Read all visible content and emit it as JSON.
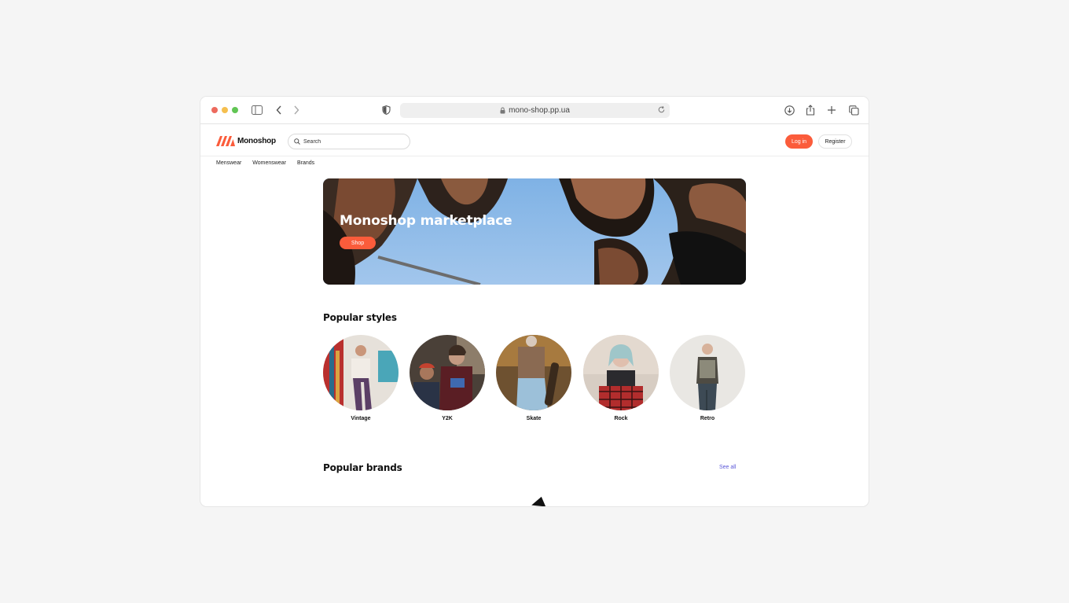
{
  "browser": {
    "url": "mono-shop.pp.ua"
  },
  "header": {
    "logo_text": "Monoshop",
    "search_placeholder": "Search",
    "login_label": "Log in",
    "register_label": "Register"
  },
  "nav": {
    "items": [
      "Menswear",
      "Womenswear",
      "Brands"
    ]
  },
  "hero": {
    "title": "Monoshop marketplace",
    "button_label": "Shop"
  },
  "popular_styles": {
    "title": "Popular styles",
    "items": [
      {
        "label": "Vintage"
      },
      {
        "label": "Y2K"
      },
      {
        "label": "Skate"
      },
      {
        "label": "Rock"
      },
      {
        "label": "Retro"
      }
    ]
  },
  "popular_brands": {
    "title": "Popular brands",
    "see_all_label": "See all"
  },
  "colors": {
    "accent": "#fb5c3b",
    "link": "#5b58d8"
  }
}
